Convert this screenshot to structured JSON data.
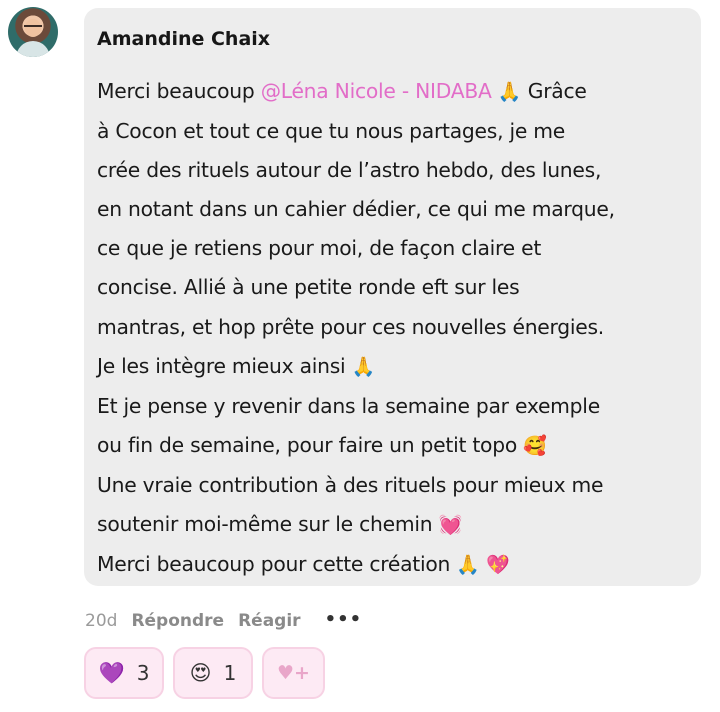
{
  "comment": {
    "author": "Amandine Chaix",
    "lines": [
      {
        "text": "Merci beaucoup ",
        "mention": "@Léna Nicole - NIDABA",
        "after": " Grâce",
        "emoji": "🙏"
      },
      {
        "text": "à Cocon et tout ce que tu nous partages, je me"
      },
      {
        "text": "crée des rituels autour de l’astro hebdo, des lunes,"
      },
      {
        "text": "en notant dans un cahier dédier, ce qui me marque,"
      },
      {
        "text": "ce que je retiens pour moi, de façon claire et"
      },
      {
        "text": "concise. Allié à une petite ronde eft sur les"
      },
      {
        "text": "mantras, et hop prête pour ces nouvelles énergies."
      },
      {
        "text": "Je les intègre mieux ainsi ",
        "emoji": "🙏"
      },
      {
        "text": "Et je pense y revenir dans la semaine par exemple"
      },
      {
        "text": "ou fin de semaine, pour faire un petit topo ",
        "emoji": "🥰"
      },
      {
        "text": "Une vraie contribution à des rituels pour mieux me"
      },
      {
        "text": "soutenir moi-même sur le chemin ",
        "emoji": "💓"
      },
      {
        "text": "Merci beaucoup pour cette création ",
        "emoji": "🙏",
        "emoji2": "💖"
      }
    ]
  },
  "actions": {
    "time": "20d",
    "reply": "Répondre",
    "react": "Réagir",
    "more": "•••"
  },
  "reactions": [
    {
      "icon": "💜",
      "icon_name": "purple-heart-icon",
      "count": "3"
    },
    {
      "icon": "😍",
      "icon_name": "heart-eyes-icon",
      "count": "1"
    }
  ],
  "add_reaction_icon": "add-reaction-icon",
  "colors": {
    "bubble": "#ededed",
    "mention": "#e26dc8",
    "reaction_bg": "#fdeaf4",
    "reaction_border": "#f7d2e4"
  }
}
